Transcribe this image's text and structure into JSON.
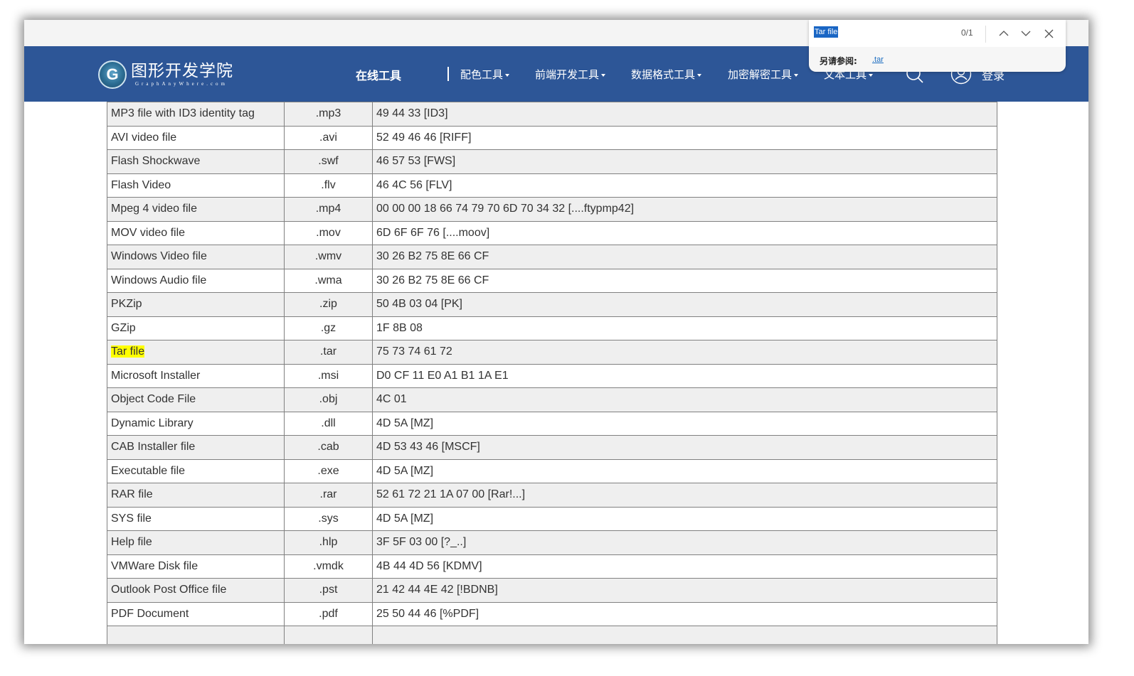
{
  "site": {
    "logo_cn": "图形开发学院",
    "logo_en": "GraphAnyWhere.com",
    "logo_badge": "G"
  },
  "nav": {
    "main": "在线工具",
    "items": [
      {
        "label": "配色工具",
        "has_dropdown": true
      },
      {
        "label": "前端开发工具",
        "has_dropdown": true
      },
      {
        "label": "数据格式工具",
        "has_dropdown": true
      },
      {
        "label": "加密解密工具",
        "has_dropdown": true
      },
      {
        "label": "文本工具",
        "has_dropdown": true
      }
    ],
    "search_icon": "search-icon",
    "user_icon": "user-icon",
    "login": "登录"
  },
  "find_bar": {
    "query": "Tar file",
    "count": "0/1",
    "see_also_label": "另请参阅:",
    "see_also_link": ".tar",
    "prev_icon": "chevron-up-icon",
    "next_icon": "chevron-down-icon",
    "close_icon": "close-icon"
  },
  "table": {
    "highlighted_term": "Tar file",
    "rows": [
      {
        "name": "MP3 file with ID3 identity tag",
        "ext": ".mp3",
        "signature": "49 44 33 [ID3]"
      },
      {
        "name": "AVI video file",
        "ext": ".avi",
        "signature": "52 49 46 46 [RIFF]"
      },
      {
        "name": "Flash Shockwave",
        "ext": ".swf",
        "signature": "46 57 53 [FWS]"
      },
      {
        "name": "Flash Video",
        "ext": ".flv",
        "signature": "46 4C 56 [FLV]"
      },
      {
        "name": "Mpeg 4 video file",
        "ext": ".mp4",
        "signature": "00 00 00 18 66 74 79 70 6D 70 34 32 [....ftypmp42]"
      },
      {
        "name": "MOV video file",
        "ext": ".mov",
        "signature": "6D 6F 6F 76 [....moov]"
      },
      {
        "name": "Windows Video file",
        "ext": ".wmv",
        "signature": "30 26 B2 75 8E 66 CF"
      },
      {
        "name": "Windows Audio file",
        "ext": ".wma",
        "signature": "30 26 B2 75 8E 66 CF"
      },
      {
        "name": "PKZip",
        "ext": ".zip",
        "signature": "50 4B 03 04 [PK]"
      },
      {
        "name": "GZip",
        "ext": ".gz",
        "signature": "1F 8B 08"
      },
      {
        "name": "Tar file",
        "ext": ".tar",
        "signature": "75 73 74 61 72"
      },
      {
        "name": "Microsoft Installer",
        "ext": ".msi",
        "signature": "D0 CF 11 E0 A1 B1 1A E1"
      },
      {
        "name": "Object Code File",
        "ext": ".obj",
        "signature": "4C 01"
      },
      {
        "name": "Dynamic Library",
        "ext": ".dll",
        "signature": "4D 5A [MZ]"
      },
      {
        "name": "CAB Installer file",
        "ext": ".cab",
        "signature": "4D 53 43 46 [MSCF]"
      },
      {
        "name": "Executable file",
        "ext": ".exe",
        "signature": "4D 5A [MZ]"
      },
      {
        "name": "RAR file",
        "ext": ".rar",
        "signature": "52 61 72 21 1A 07 00 [Rar!...]"
      },
      {
        "name": "SYS file",
        "ext": ".sys",
        "signature": "4D 5A [MZ]"
      },
      {
        "name": "Help file",
        "ext": ".hlp",
        "signature": "3F 5F 03 00 [?_..]"
      },
      {
        "name": "VMWare Disk file",
        "ext": ".vmdk",
        "signature": "4B 44 4D 56 [KDMV]"
      },
      {
        "name": "Outlook Post Office file",
        "ext": ".pst",
        "signature": "21 42 44 4E 42 [!BDNB]"
      },
      {
        "name": "PDF Document",
        "ext": ".pdf",
        "signature": "25 50 44 46 [%PDF]"
      },
      {
        "name": "",
        "ext": "",
        "signature": ""
      }
    ]
  },
  "colors": {
    "navbar": "#2d5697",
    "highlight": "#ffff00",
    "selection": "#1a66c4",
    "row_alt": "#efefef"
  }
}
